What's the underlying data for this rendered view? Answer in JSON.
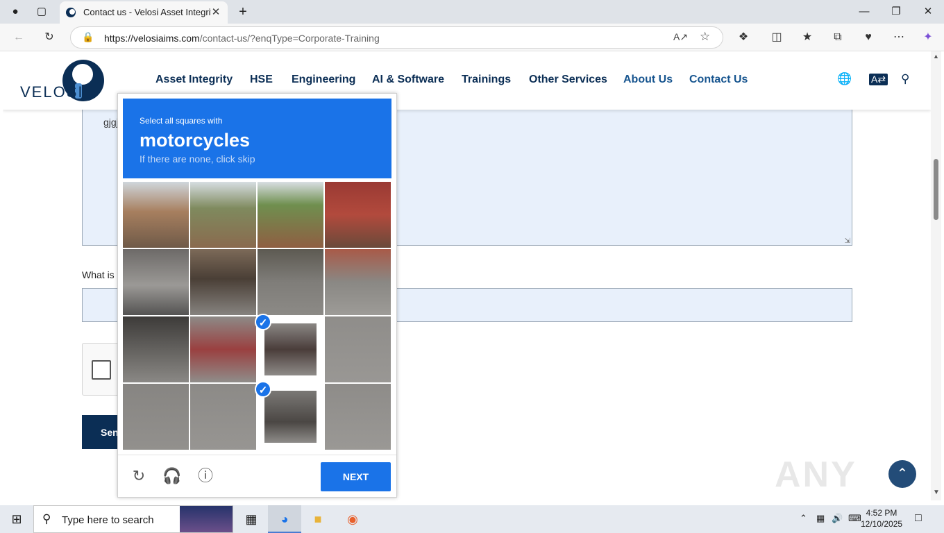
{
  "browser": {
    "tab_title": "Contact us - Velosi Asset Integrity",
    "url_host": "https://velosiaims.com",
    "url_path": "/contact-us/?enqType=Corporate-Training"
  },
  "site": {
    "logo_text": "VELOSI",
    "nav": [
      "Asset Integrity",
      "HSE",
      "Engineering",
      "AI & Software",
      "Trainings",
      "Other Services",
      "About Us",
      "Contact Us"
    ]
  },
  "form": {
    "message_text": "gjgj",
    "question_label": "What is",
    "send_label": "Sen"
  },
  "captcha": {
    "instruction": "Select all squares with",
    "target": "motorcycles",
    "hint": "If there are none, click skip",
    "next_label": "NEXT",
    "selected_tiles": [
      10,
      14
    ]
  },
  "watermark": "ANY RUN",
  "taskbar": {
    "search_placeholder": "Type here to search",
    "time": "4:52 PM",
    "date": "12/10/2025"
  },
  "colors": {
    "brand": "#0b2e55",
    "captcha_blue": "#1a73e8",
    "field_bg": "#e8f0fb"
  }
}
